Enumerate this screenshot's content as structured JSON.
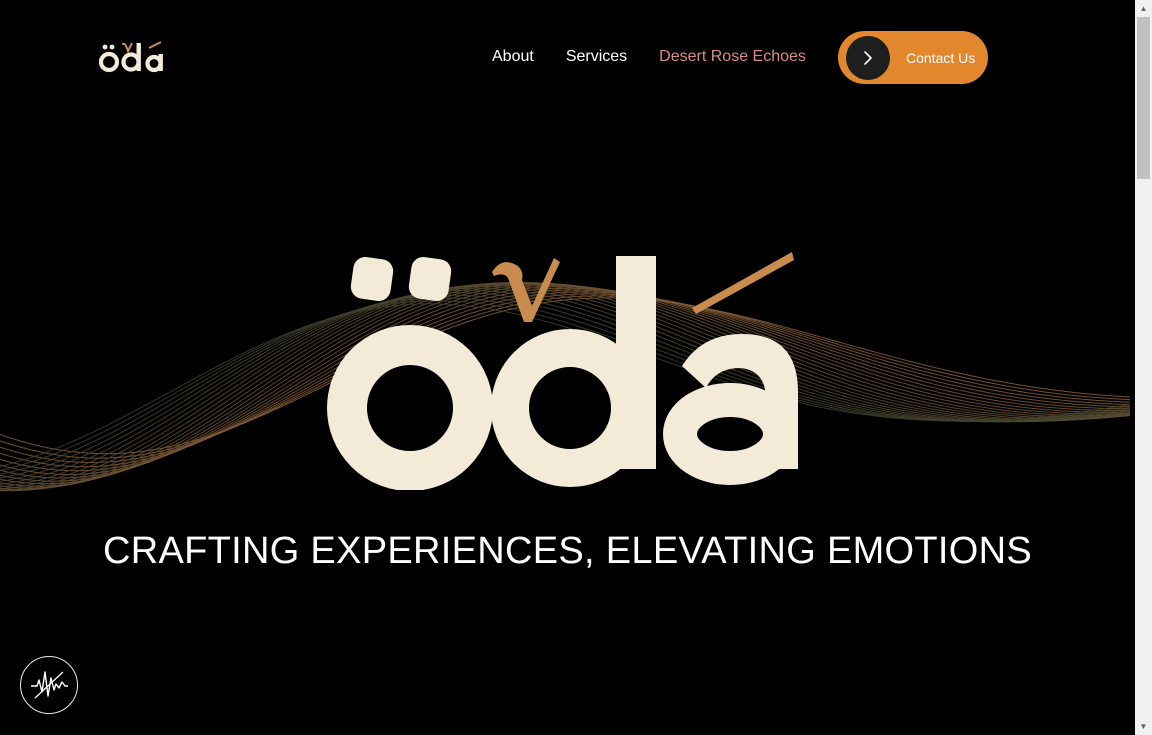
{
  "brand": {
    "logo_text": "öda",
    "colors": {
      "background": "#000000",
      "cream": "#f3ebd8",
      "accent_orange": "#e3872f",
      "logo_accent": "#c98c4f",
      "active_link": "#d98a86"
    }
  },
  "nav": {
    "items": [
      {
        "label": "About",
        "active": false
      },
      {
        "label": "Services",
        "active": false
      },
      {
        "label": "Desert Rose Echoes",
        "active": true
      }
    ],
    "contact": {
      "label": "Contact Us",
      "icon": "chevron-right-icon"
    }
  },
  "hero": {
    "logo_text": "öda",
    "tagline": "CRAFTING EXPERIENCES, ELEVATING EMOTIONS"
  },
  "sound_toggle": {
    "icon": "sound-wave-icon"
  }
}
